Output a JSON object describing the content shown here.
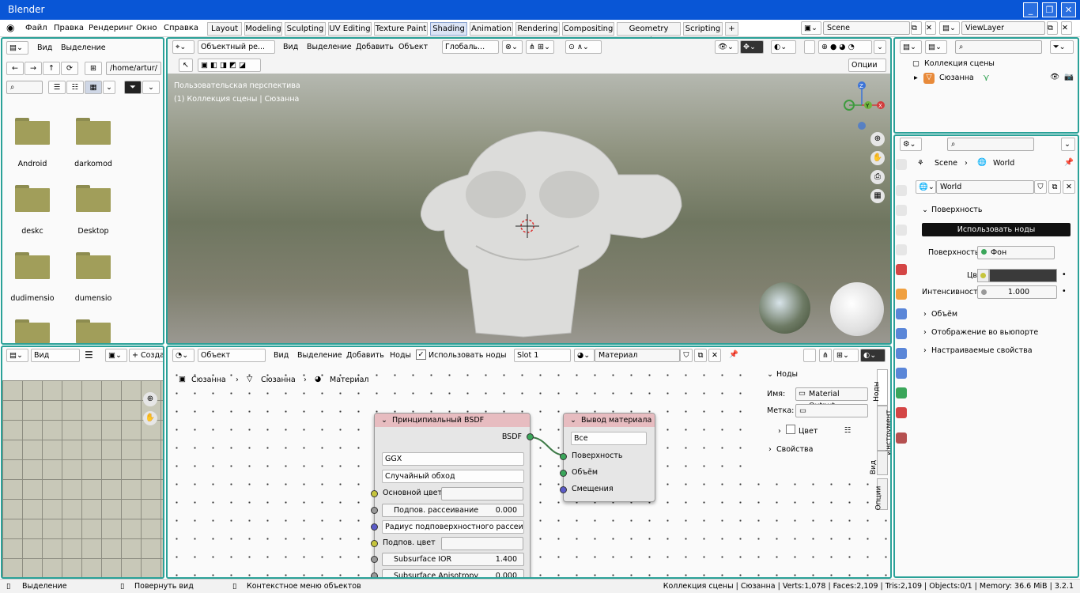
{
  "window": {
    "title": "Blender"
  },
  "menu": [
    "Файл",
    "Правка",
    "Рендеринг",
    "Окно",
    "Справка"
  ],
  "workspaces": [
    "Layout",
    "Modeling",
    "Sculpting",
    "UV Editing",
    "Texture Paint",
    "Shading",
    "Animation",
    "Rendering",
    "Compositing",
    "Geometry Nodes",
    "Scripting",
    "+"
  ],
  "active_workspace": "Shading",
  "scene": {
    "scene_name": "Scene",
    "view_layer": "ViewLayer"
  },
  "file_browser": {
    "menu_view": "Вид",
    "menu_select": "Выделение",
    "path": "/home/artur/",
    "folders": [
      "Android",
      "darkomod",
      "deskc",
      "Desktop",
      "dudimensio",
      "dumensio"
    ]
  },
  "image_editor": {
    "view": "Вид",
    "create": "+ Создат"
  },
  "viewport": {
    "mode": "Объектный ре...",
    "menus": [
      "Вид",
      "Выделение",
      "Добавить",
      "Объект"
    ],
    "orientation": "Глобаль...",
    "options": "Опции",
    "perspective": "Пользовательская перспектива",
    "collection": "(1) Коллекция сцены | Сюзанна",
    "axes": {
      "z": "Z",
      "y": "Y",
      "x": "X"
    }
  },
  "node_editor": {
    "object": "Объект",
    "menus": [
      "Вид",
      "Выделение",
      "Добавить",
      "Ноды"
    ],
    "use_nodes": "Использовать ноды",
    "slot": "Slot 1",
    "material": "Материал",
    "breadcrumb": [
      "Сюзанна",
      "Сюзанна",
      "Материал"
    ],
    "bsdf": {
      "title": "Принципиальный BSDF",
      "output": "BSDF",
      "distribution": "GGX",
      "subsurface_method": "Случайный обход",
      "base_color": "Основной цвет",
      "subsurface": "Подпов. рассеивание",
      "subsurface_value": "0.000",
      "subsurface_radius": "Радиус подповерхностного рассеив...",
      "subsurface_color": "Подпов. цвет",
      "subsurface_ior": "Subsurface IOR",
      "subsurface_ior_value": "1.400",
      "subsurface_aniso": "Subsurface Anisotropy",
      "subsurface_aniso_value": "0.000"
    },
    "output_node": {
      "title": "Вывод материала",
      "target": "Все",
      "inputs": [
        "Поверхность",
        "Объём",
        "Смещения"
      ]
    },
    "sidebar": {
      "section": "Ноды",
      "name_label": "Имя:",
      "name_value": "Material Output",
      "label_label": "Метка:",
      "color": "Цвет",
      "properties": "Свойства",
      "tabs": [
        "Ноды",
        "Инструмент",
        "Вид",
        "Опции"
      ]
    }
  },
  "outliner": {
    "collection": "Коллекция сцены",
    "object": "Сюзанна"
  },
  "properties": {
    "breadcrumb_scene": "Scene",
    "breadcrumb_world": "World",
    "world_name": "World",
    "surface_section": "Поверхность",
    "use_nodes": "Использовать ноды",
    "surface_label": "Поверхность",
    "surface_value": "Фон",
    "color_label": "Цвет",
    "strength_label": "Интенсивность",
    "strength_value": "1.000",
    "volume": "Объём",
    "viewport_display": "Отображение во вьюпорте",
    "custom_props": "Настраиваемые свойства"
  },
  "status": {
    "select": "Выделение",
    "rotate": "Повернуть вид",
    "context": "Контекстное меню объектов",
    "stats": "Коллекция сцены | Сюзанна | Verts:1,078 | Faces:2,109 | Tris:2,109 | Objects:0/1 | Memory: 36.6 MiB | 3.2.1"
  }
}
